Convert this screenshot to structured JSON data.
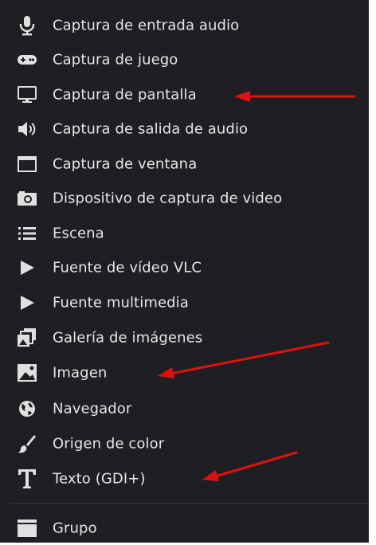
{
  "menu": {
    "items": [
      {
        "label": "Captura de entrada audio",
        "icon": "microphone-icon"
      },
      {
        "label": "Captura de juego",
        "icon": "gamepad-icon"
      },
      {
        "label": "Captura de pantalla",
        "icon": "monitor-icon"
      },
      {
        "label": "Captura de salida de audio",
        "icon": "speaker-icon"
      },
      {
        "label": "Captura de ventana",
        "icon": "window-icon"
      },
      {
        "label": "Dispositivo de captura de video",
        "icon": "camera-icon"
      },
      {
        "label": "Escena",
        "icon": "list-icon"
      },
      {
        "label": "Fuente de vídeo VLC",
        "icon": "play-icon"
      },
      {
        "label": "Fuente multimedia",
        "icon": "play-icon"
      },
      {
        "label": "Galería de imágenes",
        "icon": "image-stack-icon"
      },
      {
        "label": "Imagen",
        "icon": "image-icon"
      },
      {
        "label": "Navegador",
        "icon": "globe-icon"
      },
      {
        "label": "Origen de color",
        "icon": "brush-icon"
      },
      {
        "label": "Texto (GDI+)",
        "icon": "text-icon"
      },
      {
        "label": "Grupo",
        "icon": "folder-icon"
      }
    ]
  },
  "colors": {
    "menu_background": "#1f1f23",
    "text": "#e6e6e6",
    "icon": "#e0e0e0",
    "annotation_arrow": "#e01010"
  }
}
